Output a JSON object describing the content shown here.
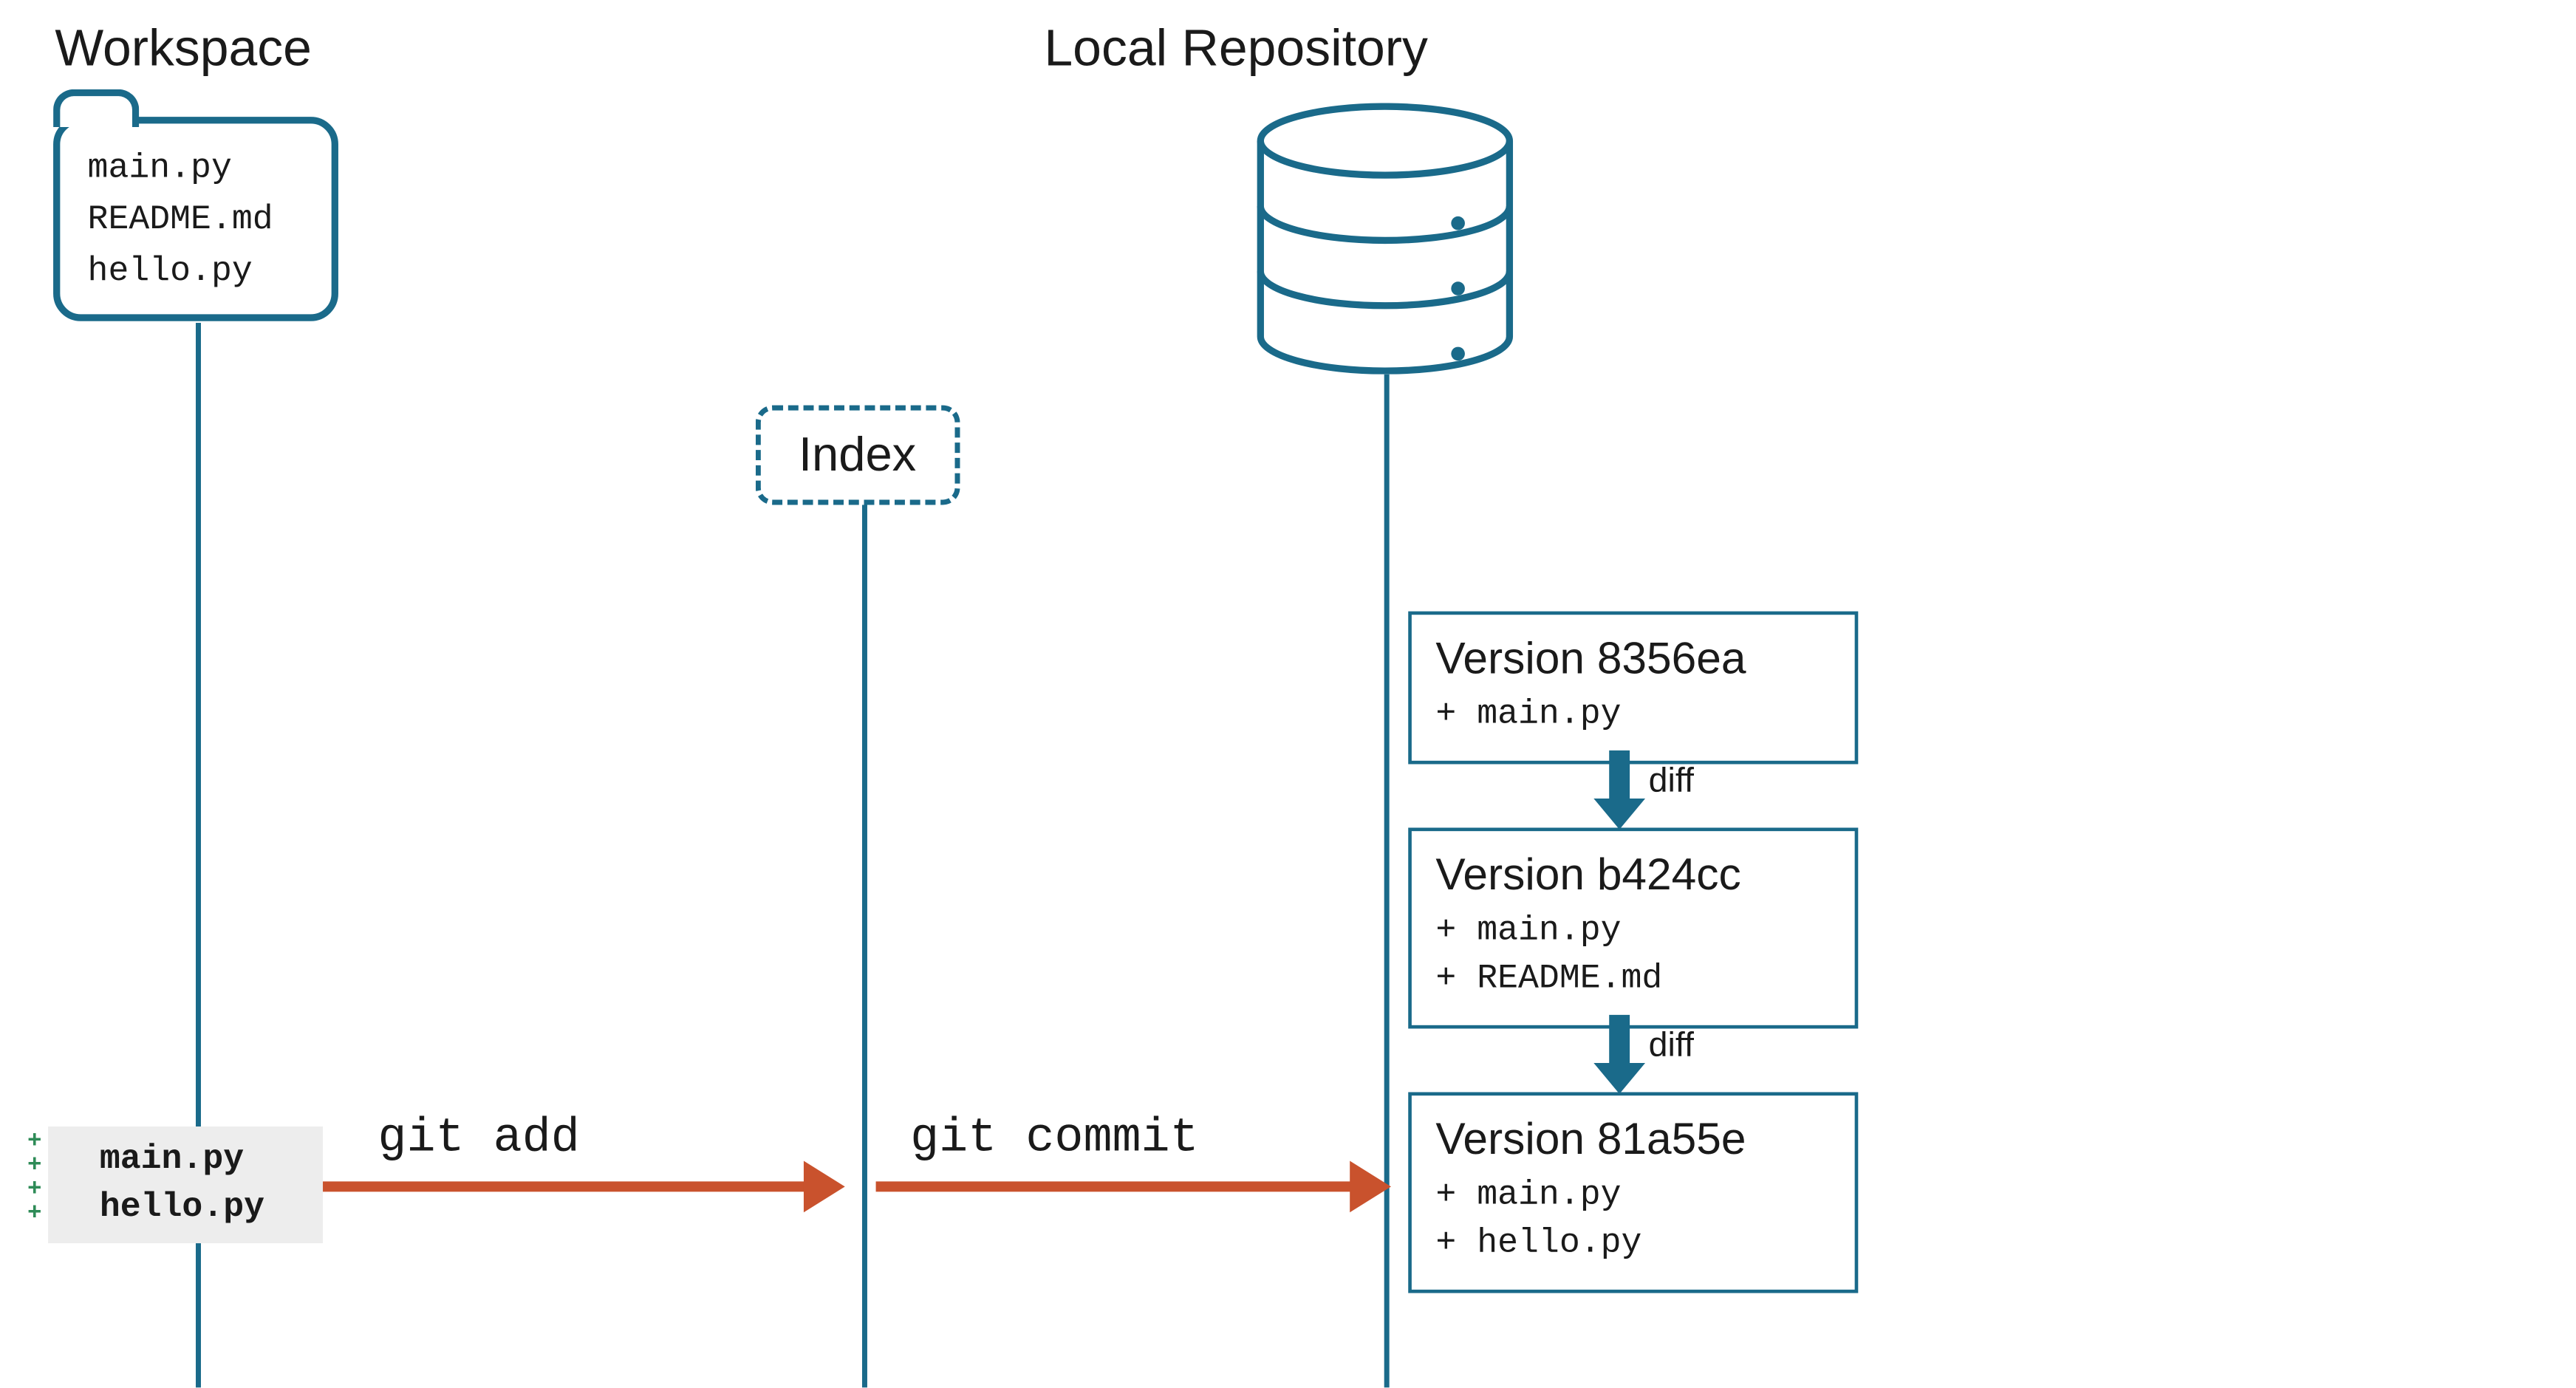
{
  "headings": {
    "workspace": "Workspace",
    "local_repo": "Local Repository"
  },
  "folder_files": [
    "main.py",
    "README.md",
    "hello.py"
  ],
  "index_label": "Index",
  "commands": {
    "add": "git add",
    "commit": "git commit"
  },
  "diff_label": "diff",
  "staged_files": [
    "main.py",
    "hello.py"
  ],
  "versions": [
    {
      "title": "Version 8356ea",
      "files": [
        "+ main.py"
      ]
    },
    {
      "title": "Version b424cc",
      "files": [
        "+ main.py",
        "+ README.md"
      ]
    },
    {
      "title": "Version 81a55e",
      "files": [
        "+ main.py",
        "+ hello.py"
      ]
    }
  ],
  "colors": {
    "teal": "#1a6a8a",
    "orange": "#c9522d",
    "green": "#2e8b57"
  }
}
